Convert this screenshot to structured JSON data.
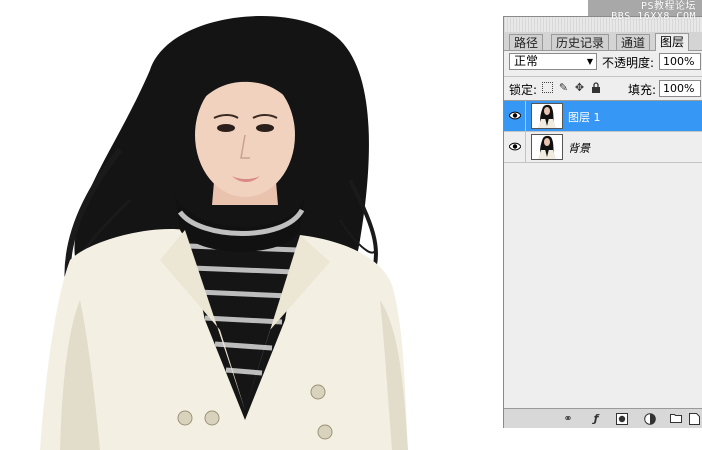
{
  "watermark": {
    "line1": "PS教程论坛",
    "line2": "BBS.16XX8.COM"
  },
  "canvas": {
    "subject": "photo of a woman in a white jacket and striped turtleneck"
  },
  "layers_panel": {
    "tabs": [
      {
        "label": "路径",
        "active": false
      },
      {
        "label": "历史记录",
        "active": false
      },
      {
        "label": "通道",
        "active": false
      },
      {
        "label": "图层",
        "active": true
      }
    ],
    "blend_mode": "正常",
    "opacity_label": "不透明度:",
    "opacity_value": "100%",
    "lock_label": "锁定:",
    "lock_icons": [
      "lock-transparent-icon",
      "lock-paint-icon",
      "lock-move-icon",
      "lock-all-icon"
    ],
    "fill_label": "填充:",
    "fill_value": "100%",
    "layers": [
      {
        "name": "图层 1",
        "selected": true,
        "visible": true
      },
      {
        "name": "背景",
        "selected": false,
        "visible": true
      }
    ],
    "footer_icons": [
      "link-layers-icon",
      "layer-style-icon",
      "layer-mask-icon",
      "adjustment-layer-icon",
      "new-group-icon",
      "new-layer-icon"
    ],
    "colors": {
      "selection": "#3797f5",
      "panel_bg": "#eeeeee"
    }
  }
}
